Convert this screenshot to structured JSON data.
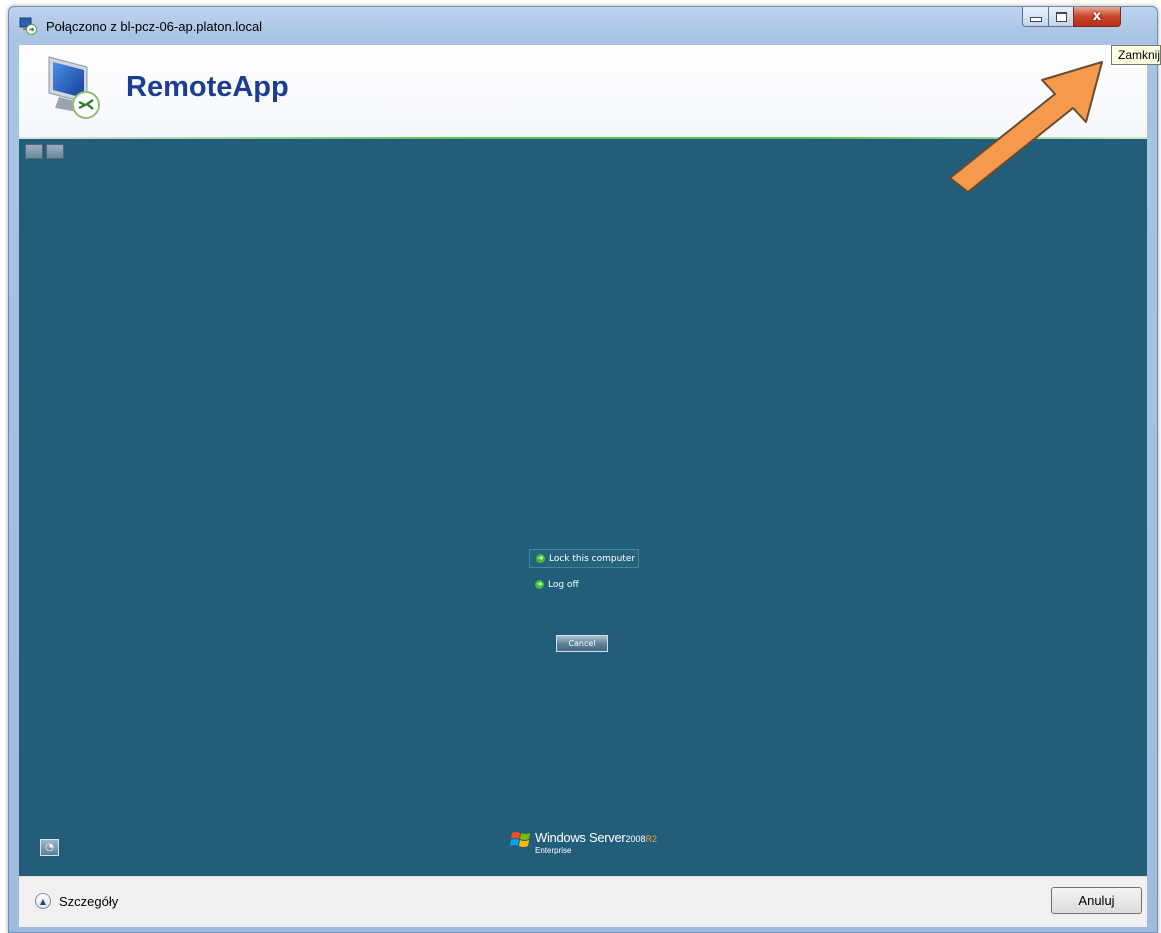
{
  "window": {
    "title": "Połączono z bl-pcz-06-ap.platon.local",
    "close_tooltip": "Zamknij",
    "close_glyph": "x"
  },
  "header": {
    "app_title": "RemoteApp"
  },
  "session": {
    "menu_items": [
      {
        "label": "Lock this computer",
        "icon": "green-arrow-icon",
        "selected": true
      },
      {
        "label": "Log off",
        "icon": "green-arrow-icon",
        "selected": false
      }
    ],
    "cancel_label": "Cancel",
    "brand": {
      "name": "Windows Server",
      "year": "2008",
      "release": "R2",
      "edition": "Enterprise"
    }
  },
  "footer": {
    "details_label": "Szczegóły",
    "cancel_label": "Anuluj"
  },
  "colors": {
    "session_bg": "#225e7a",
    "annotation_arrow": "#f39a4d",
    "title_text": "#1c3d92",
    "menu_icon": "#39c235"
  }
}
